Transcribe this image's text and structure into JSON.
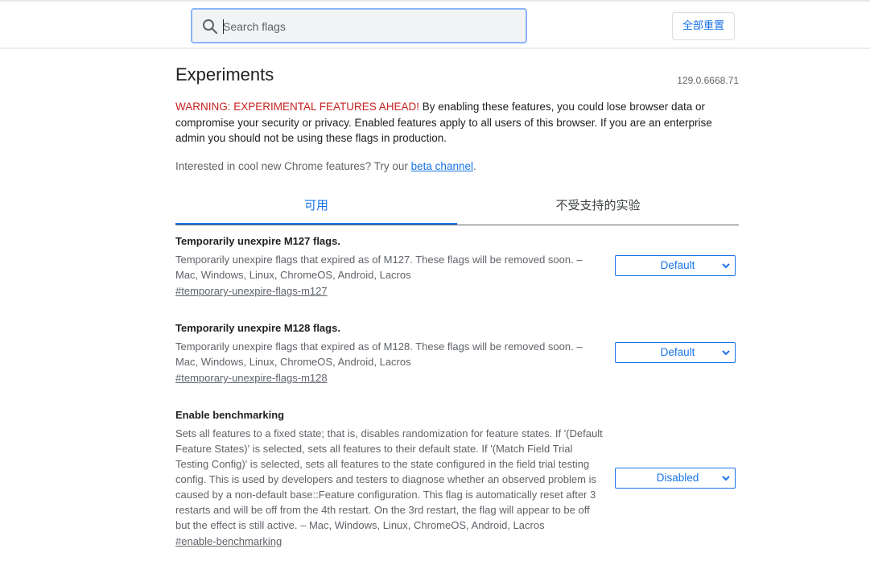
{
  "search": {
    "placeholder": "Search flags",
    "value": ""
  },
  "header": {
    "reset_label": "全部重置"
  },
  "page": {
    "title": "Experiments",
    "version": "129.0.6668.71",
    "warning_prefix": "WARNING: EXPERIMENTAL FEATURES AHEAD!",
    "warning_body": " By enabling these features, you could lose browser data or compromise your security or privacy. Enabled features apply to all users of this browser. If you are an enterprise admin you should not be using these flags in production.",
    "interest_prefix": "Interested in cool new Chrome features? Try our ",
    "interest_link": "beta channel",
    "interest_suffix": "."
  },
  "tabs": [
    {
      "label": "可用",
      "active": true
    },
    {
      "label": "不受支持的实验",
      "active": false
    }
  ],
  "experiments": [
    {
      "title": "Temporarily unexpire M127 flags.",
      "description": "Temporarily unexpire flags that expired as of M127. These flags will be removed soon. – Mac, Windows, Linux, ChromeOS, Android, Lacros",
      "link": "#temporary-unexpire-flags-m127",
      "state": "Default"
    },
    {
      "title": "Temporarily unexpire M128 flags.",
      "description": "Temporarily unexpire flags that expired as of M128. These flags will be removed soon. – Mac, Windows, Linux, ChromeOS, Android, Lacros",
      "link": "#temporary-unexpire-flags-m128",
      "state": "Default"
    },
    {
      "title": "Enable benchmarking",
      "description": "Sets all features to a fixed state; that is, disables randomization for feature states. If '(Default Feature States)' is selected, sets all features to their default state. If '(Match Field Trial Testing Config)' is selected, sets all features to the state configured in the field trial testing config. This is used by developers and testers to diagnose whether an observed problem is caused by a non-default base::Feature configuration. This flag is automatically reset after 3 restarts and will be off from the 4th restart. On the 3rd restart, the flag will appear to be off but the effect is still active. – Mac, Windows, Linux, ChromeOS, Android, Lacros",
      "link": "#enable-benchmarking",
      "state": "Disabled"
    }
  ],
  "icons": {
    "search": "search-icon",
    "chevron": "chevron-down-icon"
  },
  "colors": {
    "accent": "#1a73e8",
    "warning": "#c5221f",
    "search_border": "#8ab4f8"
  }
}
